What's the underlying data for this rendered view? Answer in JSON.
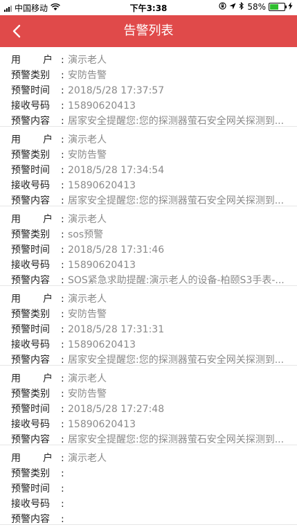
{
  "status_bar": {
    "carrier": "中国移动",
    "time": "下午3:38",
    "battery": "58%",
    "battery_level": 0.58,
    "wifi_icon": "wifi-icon",
    "location_icon": "location-arrow-icon",
    "bluetooth_icon": "bluetooth-icon",
    "lock_icon": "rotation-lock-icon",
    "charging_icon": "charging-bolt-icon"
  },
  "header": {
    "title": "告警列表",
    "back_icon": "back-chevron-icon",
    "background": "#e04a4a"
  },
  "labels": {
    "user_a": "用",
    "user_b": "户",
    "type": "预警类别",
    "time": "预警时间",
    "phone": "接收号码",
    "content": "预警内容",
    "colon": ":"
  },
  "alerts": [
    {
      "user": "演示老人",
      "type": "安防告警",
      "time": "2018/5/28 17:37:57",
      "phone": "15890620413",
      "content": "居家安全提醒您:您的探测器萤石安全网关探测到..."
    },
    {
      "user": "演示老人",
      "type": "安防告警",
      "time": "2018/5/28 17:34:54",
      "phone": "15890620413",
      "content": "居家安全提醒您:您的探测器萤石安全网关探测到..."
    },
    {
      "user": "演示老人",
      "type": "sos预警",
      "time": "2018/5/28 17:31:46",
      "phone": "15890620413",
      "content": "SOS紧急求助提醒:演示老人的设备-柏颐S3手表-..."
    },
    {
      "user": "演示老人",
      "type": "安防告警",
      "time": "2018/5/28 17:31:31",
      "phone": "15890620413",
      "content": "居家安全提醒您:您的探测器萤石安全网关探测到..."
    },
    {
      "user": "演示老人",
      "type": "安防告警",
      "time": "2018/5/28 17:27:48",
      "phone": "15890620413",
      "content": "居家安全提醒您:您的探测器萤石安全网关探测到..."
    },
    {
      "user": "演示老人",
      "type": "",
      "time": "",
      "phone": "",
      "content": ""
    }
  ]
}
